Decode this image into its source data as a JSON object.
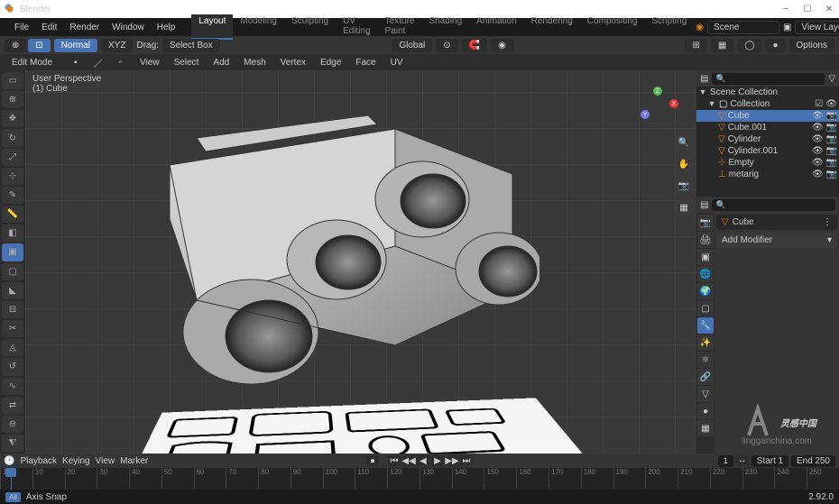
{
  "app": {
    "title": "Blender",
    "version": "2.92.0"
  },
  "window": {
    "minimize": "−",
    "maximize": "☐",
    "close": "✕"
  },
  "menu": [
    "File",
    "Edit",
    "Render",
    "Window",
    "Help"
  ],
  "workspaces": [
    "Layout",
    "Modeling",
    "Sculpting",
    "UV Editing",
    "Texture Paint",
    "Shading",
    "Animation",
    "Rendering",
    "Compositing",
    "Scripting"
  ],
  "active_workspace": 0,
  "scene": {
    "label": "Scene",
    "view_layer": "View Layer"
  },
  "toolbar": {
    "normal": "Normal",
    "xyz": "XYZ",
    "drag": "Drag:",
    "select_box": "Select Box",
    "global": "Global",
    "options": "Options"
  },
  "header": {
    "mode": "Edit Mode",
    "menus": [
      "View",
      "Select",
      "Add",
      "Mesh",
      "Vertex",
      "Edge",
      "Face",
      "UV"
    ]
  },
  "viewport": {
    "perspective": "User Perspective",
    "object": "(1) Cube"
  },
  "gizmo": {
    "x": "X",
    "y": "Y",
    "z": "Z"
  },
  "outliner": {
    "scene_collection": "Scene Collection",
    "collection": "Collection",
    "items": [
      {
        "name": "Cube",
        "selected": true
      },
      {
        "name": "Cube.001",
        "selected": false
      },
      {
        "name": "Cylinder",
        "selected": false
      },
      {
        "name": "Cylinder.001",
        "selected": false
      },
      {
        "name": "Empty",
        "selected": false
      },
      {
        "name": "metarig",
        "selected": false
      }
    ]
  },
  "properties": {
    "object": "Cube",
    "add_modifier": "Add Modifier"
  },
  "timeline": {
    "playback": "Playback",
    "keying": "Keying",
    "view": "View",
    "marker": "Marker",
    "current": "1",
    "start_label": "Start",
    "start": "1",
    "end_label": "End",
    "end": "250",
    "ticks": [
      "1",
      "10",
      "20",
      "30",
      "40",
      "50",
      "60",
      "70",
      "80",
      "90",
      "100",
      "110",
      "120",
      "130",
      "140",
      "150",
      "160",
      "170",
      "180",
      "190",
      "200",
      "210",
      "220",
      "230",
      "240",
      "250"
    ]
  },
  "status": {
    "mode": "All",
    "axis_snap": "Axis Snap"
  },
  "watermark": {
    "main": "灵感中国",
    "sub": "lingganchina.com"
  }
}
